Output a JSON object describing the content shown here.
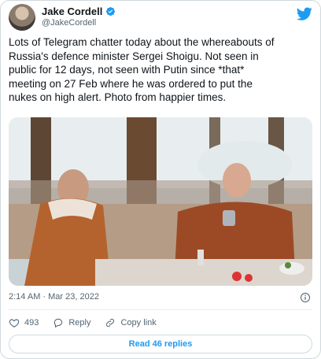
{
  "author": {
    "display_name": "Jake Cordell",
    "handle": "@JakeCordell",
    "verified": true
  },
  "tweet": {
    "text": "Lots of Telegram chatter today about the whereabouts of\nRussia's defence minister Sergei Shoigu. Not seen in\npublic for 12 days, not seen with Putin since *that*\nmeeting on 27 Feb where he was ordered to put the\nnukes on high alert. Photo from happier times.",
    "timestamp": "2:14 AM · Mar 23, 2022"
  },
  "actions": {
    "like_count": "493",
    "reply_label": "Reply",
    "copy_link_label": "Copy link"
  },
  "read_replies_label": "Read 46 replies",
  "colors": {
    "accent": "#1d9bf0",
    "text": "#0f1419",
    "secondary": "#536471",
    "border": "#cfd9de"
  },
  "icons": [
    "verified-badge-icon",
    "twitter-bird-icon",
    "info-icon",
    "heart-icon",
    "reply-icon",
    "link-icon"
  ]
}
